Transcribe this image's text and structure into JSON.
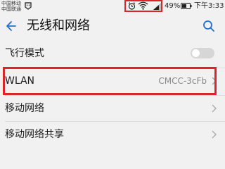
{
  "status_bar": {
    "carrier_1": "中国移动",
    "carrier_2": "中国联通",
    "battery_percent": "49%",
    "time": "下午3:33",
    "icons": [
      "notification-icon",
      "alarm-icon",
      "wifi-icon",
      "signal-icon",
      "battery-icon"
    ],
    "highlight_color": "#d9262c"
  },
  "header": {
    "title": "无线和网络",
    "back_icon": "back-arrow-icon",
    "search_icon": "search-icon",
    "accent": "#1f6fd0"
  },
  "settings": {
    "airplane_mode": {
      "label": "飞行模式",
      "toggle_on": false
    },
    "wlan": {
      "label": "WLAN",
      "value": "CMCC-3cFb"
    },
    "mobile_network": {
      "label": "移动网络"
    },
    "mobile_network_share": {
      "label": "移动网络共享"
    }
  }
}
